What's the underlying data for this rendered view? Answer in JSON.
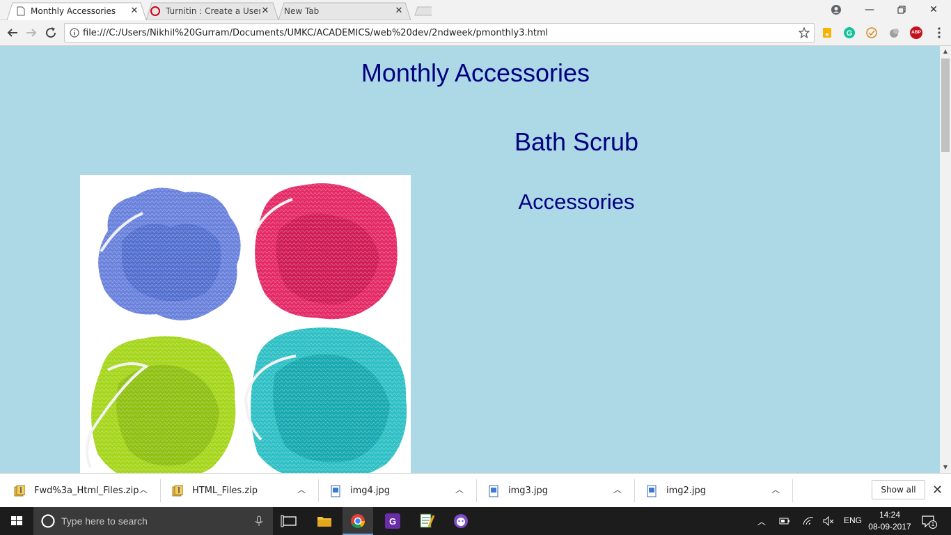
{
  "browser": {
    "tabs": [
      {
        "title": "Monthly Accessories",
        "active": true
      },
      {
        "title": "Turnitin : Create a User P",
        "active": false
      },
      {
        "title": "New Tab",
        "active": false
      }
    ],
    "url": "file:///C:/Users/Nikhil%20Gurram/Documents/UMKC/ACADEMICS/web%20dev/2ndweek/pmonthly3.html",
    "extensions": [
      "keep-icon",
      "grammarly-icon",
      "pocket-icon",
      "extension-icon",
      "adblock-plus-icon"
    ],
    "adblock_label": "ABP"
  },
  "page": {
    "heading": "Monthly Accessories",
    "product_title": "Bath Scrub",
    "category": "Accessories",
    "bg_color": "#add8e6",
    "text_color": "#000080"
  },
  "downloads": {
    "items": [
      {
        "name": "Fwd%3a_Html_Files.zip",
        "icon": "zip-file-icon"
      },
      {
        "name": "HTML_Files.zip",
        "icon": "zip-file-icon"
      },
      {
        "name": "img4.jpg",
        "icon": "image-file-icon"
      },
      {
        "name": "img3.jpg",
        "icon": "image-file-icon"
      },
      {
        "name": "img2.jpg",
        "icon": "image-file-icon"
      }
    ],
    "show_all_label": "Show all"
  },
  "taskbar": {
    "search_placeholder": "Type here to search",
    "language": "ENG",
    "time": "14:24",
    "date": "08-09-2017",
    "notification_count": "1"
  }
}
